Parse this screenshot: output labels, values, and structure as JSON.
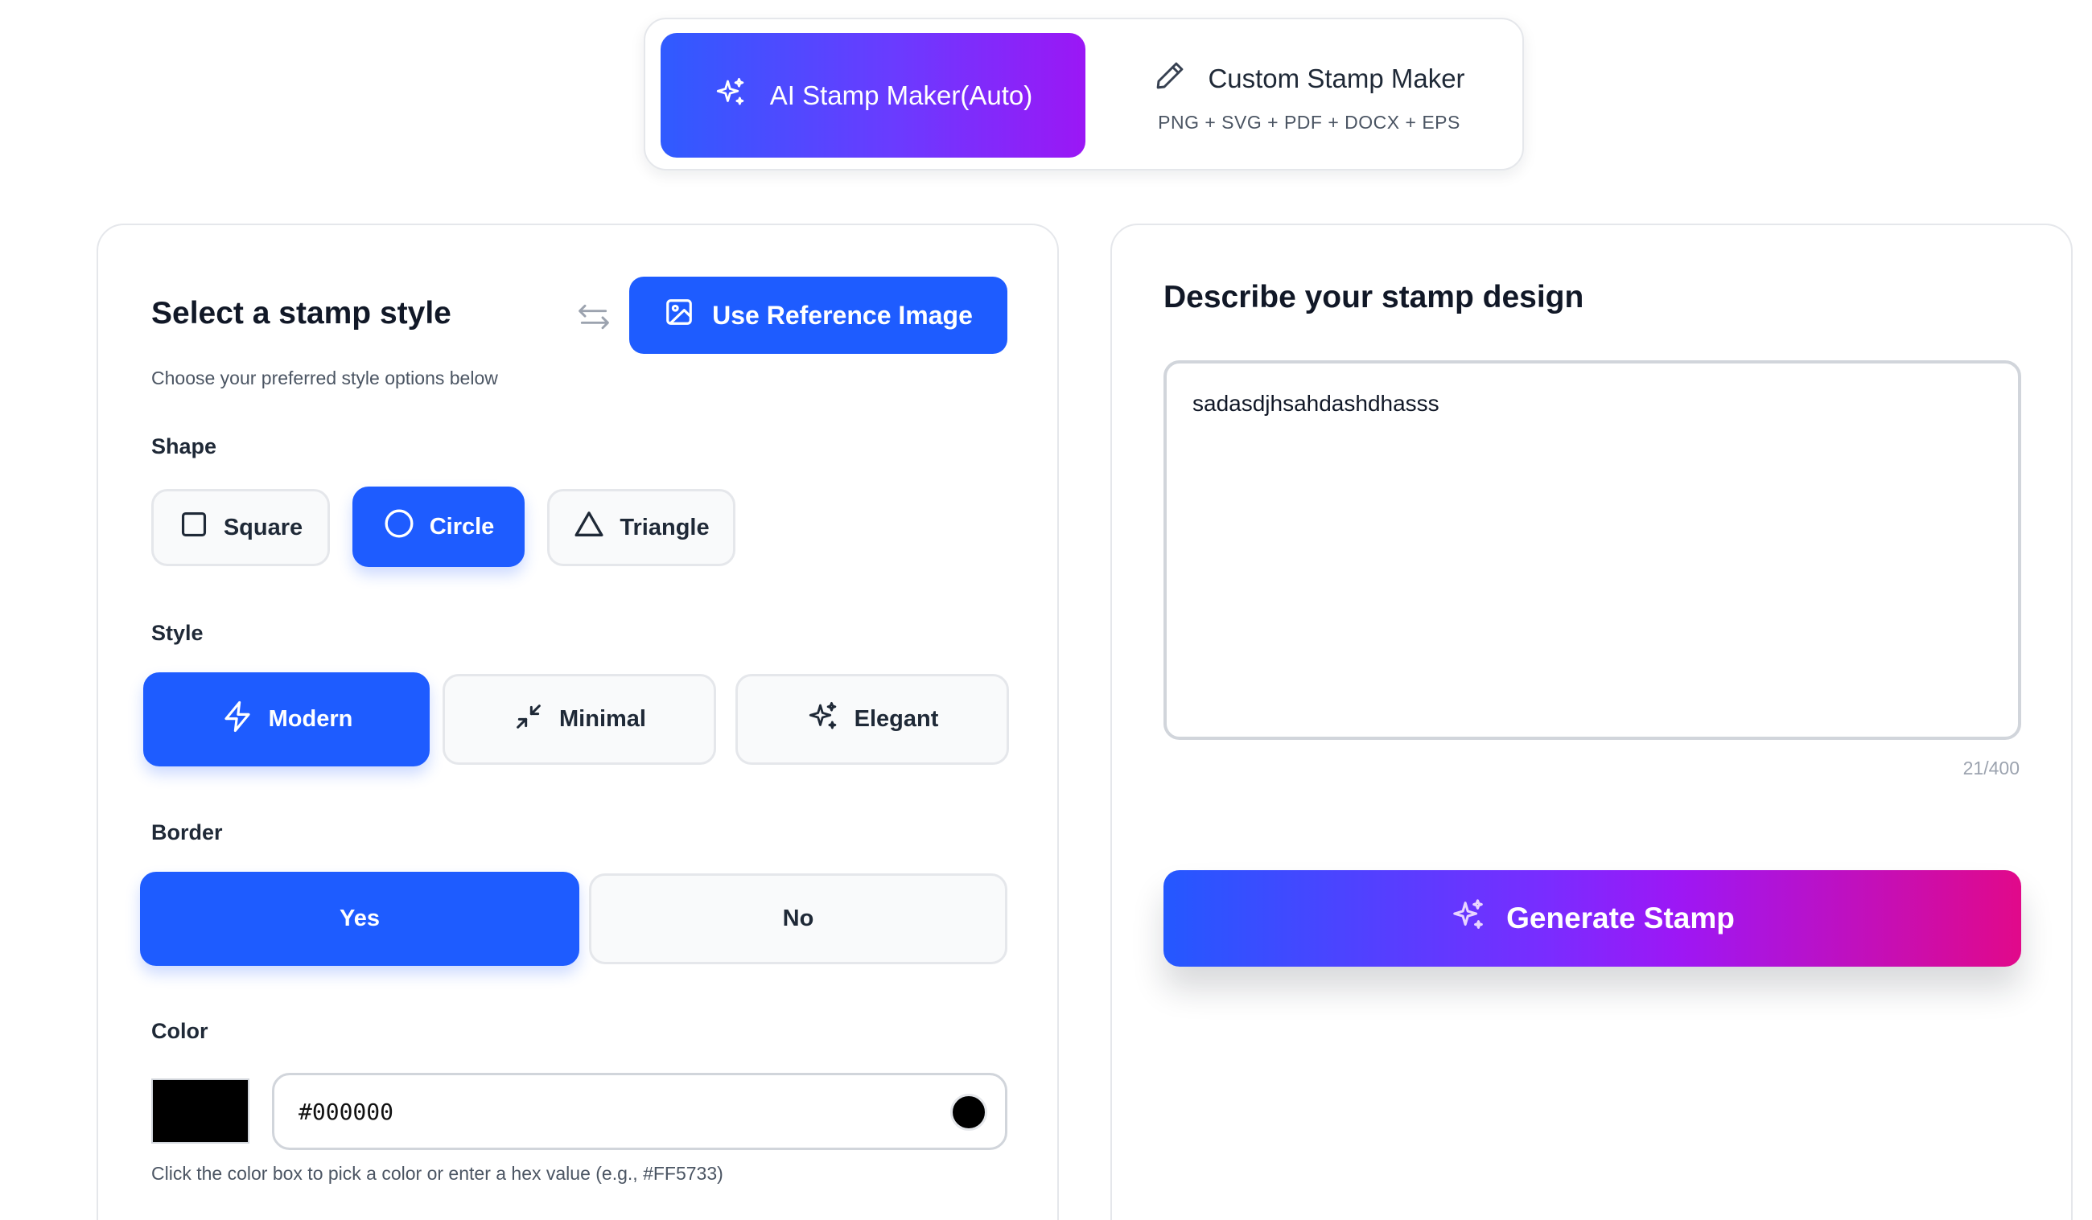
{
  "mode_switch": {
    "ai": {
      "label": "AI Stamp Maker(Auto)",
      "icon": "sparkles-icon"
    },
    "custom": {
      "label": "Custom Stamp Maker",
      "formats": "PNG + SVG + PDF + DOCX + EPS",
      "icon": "pencil-icon"
    }
  },
  "style_panel": {
    "title": "Select a stamp style",
    "subtitle": "Choose your preferred style options below",
    "reference_button": "Use Reference Image",
    "shape": {
      "label": "Shape",
      "options": [
        "Square",
        "Circle",
        "Triangle"
      ],
      "selected": "Circle"
    },
    "style": {
      "label": "Style",
      "options": [
        "Modern",
        "Minimal",
        "Elegant"
      ],
      "selected": "Modern"
    },
    "border": {
      "label": "Border",
      "options": [
        "Yes",
        "No"
      ],
      "selected": "Yes"
    },
    "color": {
      "label": "Color",
      "value": "#000000",
      "hint": "Click the color box to pick a color or enter a hex value (e.g., #FF5733)"
    }
  },
  "describe_panel": {
    "title": "Describe your stamp design",
    "text": "sadasdjhsahdashdhasss",
    "counter": "21/400",
    "generate_button": "Generate Stamp"
  },
  "colors": {
    "primary": "#1e5cff",
    "gradient_start": "#2f5bff",
    "gradient_mid": "#9b17f5",
    "gradient_end": "#e1098a"
  }
}
